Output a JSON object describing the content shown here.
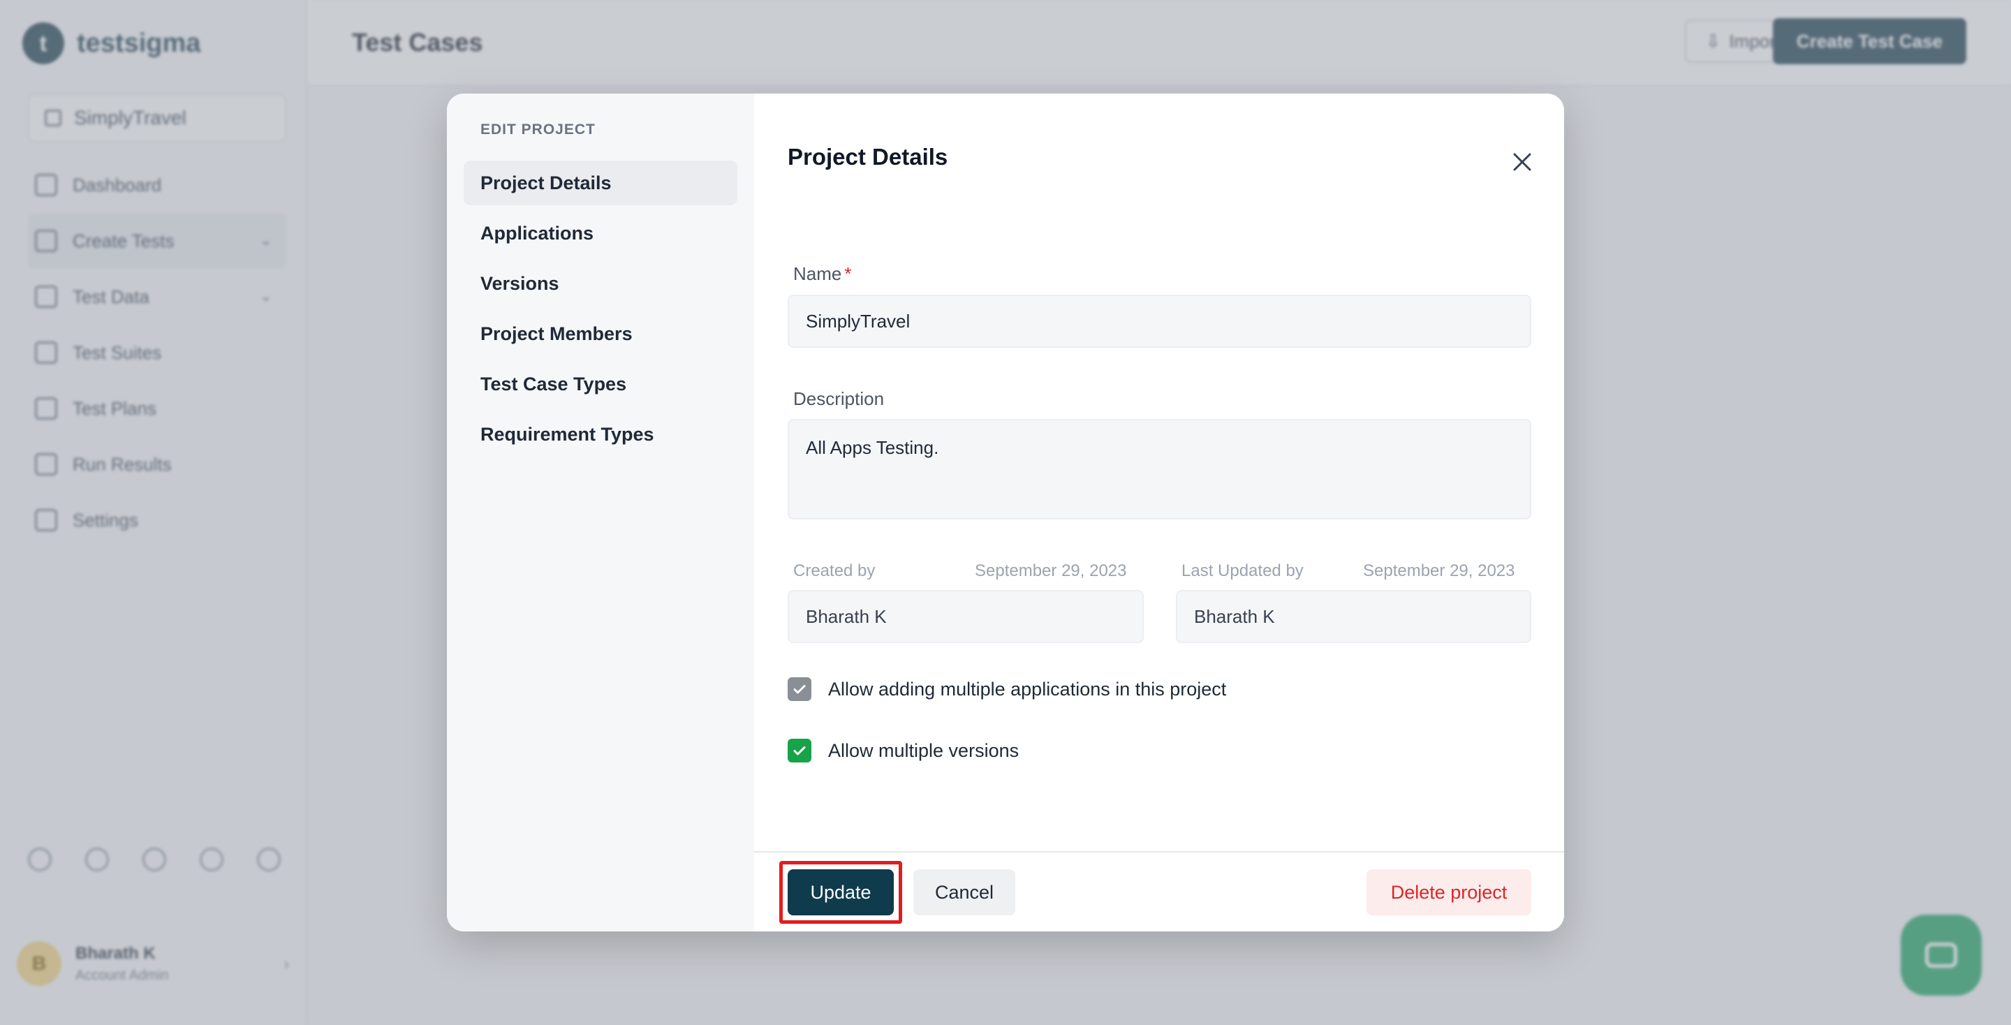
{
  "background": {
    "brand": {
      "logo_letter": "t",
      "name": "testsigma"
    },
    "project_switcher": "SimplyTravel",
    "nav": [
      {
        "label": "Dashboard",
        "has_chevron": false
      },
      {
        "label": "Create Tests",
        "has_chevron": true,
        "active": true
      },
      {
        "label": "Test Data",
        "has_chevron": true
      },
      {
        "label": "Test Suites",
        "has_chevron": false
      },
      {
        "label": "Test Plans",
        "has_chevron": false
      },
      {
        "label": "Run Results",
        "has_chevron": false
      },
      {
        "label": "Settings",
        "has_chevron": false
      }
    ],
    "user": {
      "initial": "B",
      "name": "Bharath K",
      "subtitle": "Account Admin"
    },
    "page_title": "Test Cases",
    "import_label": "Import",
    "create_label": "Create Test Case"
  },
  "modal": {
    "nav_heading": "EDIT PROJECT",
    "nav_items": [
      {
        "label": "Project Details",
        "active": true
      },
      {
        "label": "Applications"
      },
      {
        "label": "Versions"
      },
      {
        "label": "Project Members"
      },
      {
        "label": "Test Case Types"
      },
      {
        "label": "Requirement Types"
      }
    ],
    "title": "Project Details",
    "name": {
      "label": "Name",
      "required_mark": "*",
      "value": "SimplyTravel"
    },
    "description": {
      "label": "Description",
      "value": "All Apps Testing."
    },
    "created": {
      "label": "Created by",
      "date": "September 29, 2023",
      "value": "Bharath K"
    },
    "updated": {
      "label": "Last Updated by",
      "date": "September 29, 2023",
      "value": "Bharath K"
    },
    "options": [
      {
        "label": "Allow adding multiple applications in this project",
        "checked": true,
        "color": "#8a8f96"
      },
      {
        "label": "Allow multiple versions",
        "checked": true,
        "color": "#16a34a"
      }
    ],
    "footer": {
      "update": "Update",
      "cancel": "Cancel",
      "delete": "Delete project"
    }
  }
}
